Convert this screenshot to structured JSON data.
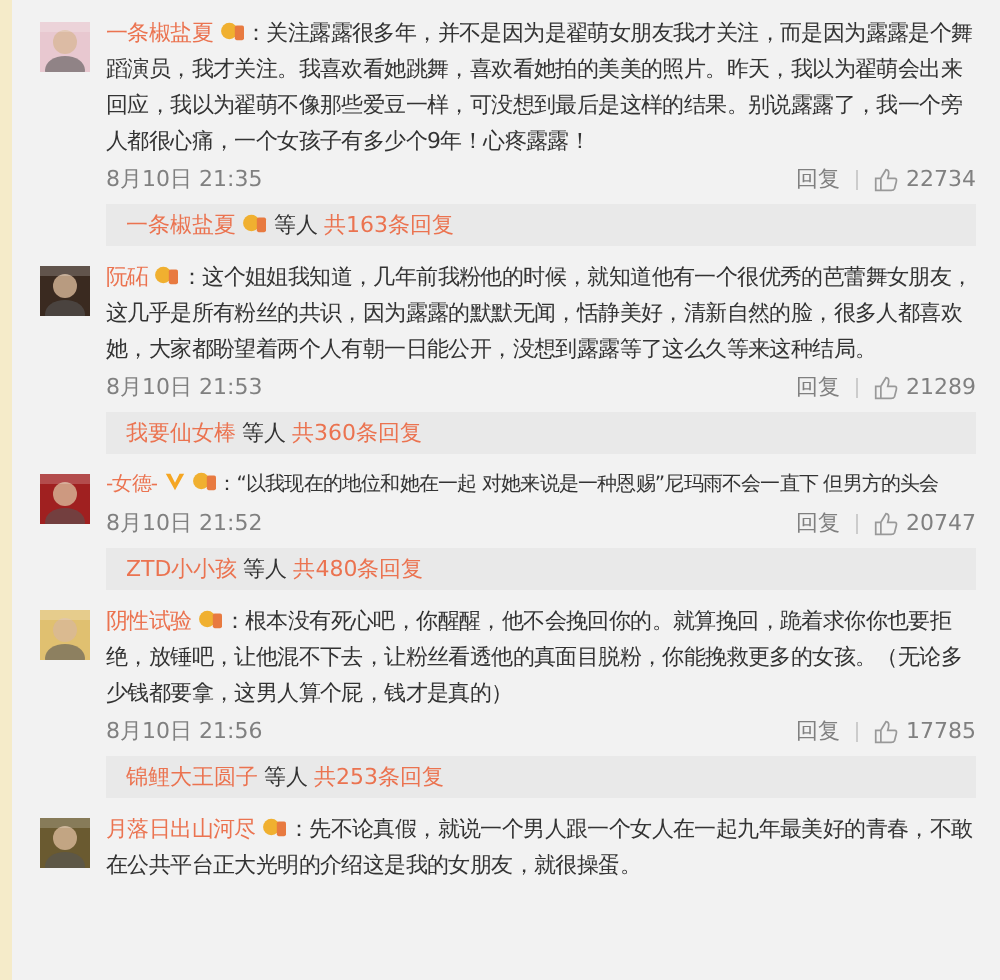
{
  "comments": [
    {
      "user": "一条椒盐夏",
      "verified": false,
      "text": "：关注露露很多年，并不是因为是翟萌女朋友我才关注，而是因为露露是个舞蹈演员，我才关注。我喜欢看她跳舞，喜欢看她拍的美美的照片。昨天，我以为翟萌会出来回应，我以为翟萌不像那些爱豆一样，可没想到最后是这样的结果。别说露露了，我一个旁人都很心痛，一个女孩子有多少个9年！心疼露露！",
      "nowrap": false,
      "time": "8月10日 21:35",
      "reply_label": "回复",
      "likes": "22734",
      "replies": {
        "names": "一条椒盐夏",
        "badge": true,
        "suffix": "等人",
        "count": "共163条回复"
      }
    },
    {
      "user": "阮砳",
      "verified": false,
      "text": "：这个姐姐我知道，几年前我粉他的时候，就知道他有一个很优秀的芭蕾舞女朋友，这几乎是所有粉丝的共识，因为露露的默默无闻，恬静美好，清新自然的脸，很多人都喜欢她，大家都盼望着两个人有朝一日能公开，没想到露露等了这么久等来这种结局。",
      "nowrap": false,
      "time": "8月10日 21:53",
      "reply_label": "回复",
      "likes": "21289",
      "replies": {
        "names": "我要仙女棒",
        "badge": false,
        "suffix": "等人",
        "count": "共360条回复"
      }
    },
    {
      "user": "-女德-",
      "verified": true,
      "text": "：“以我现在的地位和她在一起 对她来说是一种恩赐”尼玛雨不会一直下 但男方的头会",
      "nowrap": true,
      "time": "8月10日 21:52",
      "reply_label": "回复",
      "likes": "20747",
      "replies": {
        "names": "ZTD小小孩",
        "badge": false,
        "suffix": "等人",
        "count": "共480条回复"
      }
    },
    {
      "user": "阴性试验",
      "verified": false,
      "text": "：根本没有死心吧，你醒醒，他不会挽回你的。就算挽回，跪着求你你也要拒绝，放锤吧，让他混不下去，让粉丝看透他的真面目脱粉，你能挽救更多的女孩。（无论多少钱都要拿，这男人算个屁，钱才是真的）",
      "nowrap": false,
      "time": "8月10日 21:56",
      "reply_label": "回复",
      "likes": "17785",
      "replies": {
        "names": "锦鲤大王圆子",
        "badge": false,
        "suffix": "等人",
        "count": "共253条回复"
      }
    },
    {
      "user": "月落日出山河尽",
      "verified": false,
      "text": "：先不论真假，就说一个男人跟一个女人在一起九年最美好的青春，不敢在公共平台正大光明的介绍这是我的女朋友，就很操蛋。",
      "nowrap": false
    }
  ]
}
